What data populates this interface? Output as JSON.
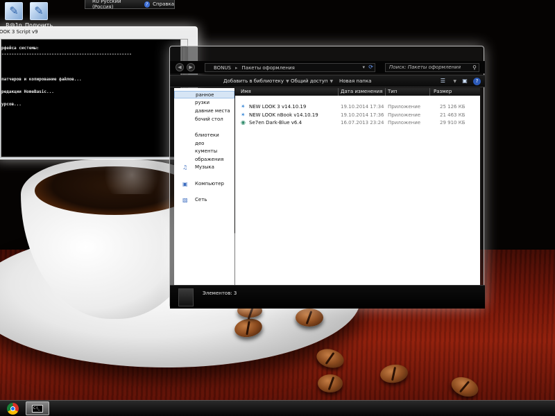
{
  "desktop": {
    "icons": [
      {
        "label": "R@1n",
        "icon": "shortcut-icon"
      },
      {
        "label": "Получить",
        "icon": "shortcut-icon"
      }
    ]
  },
  "langbar": {
    "language": "RU Русский (Россия)",
    "help": "Справка"
  },
  "console": {
    "title": "OOK 3 Script v9",
    "lines": [
      "рфейса системы:",
      "----------------------------------------------------",
      "",
      "",
      "",
      "патчеров и копирование файлов...",
      "",
      "редакции HomeBasic...",
      "",
      "урсов..."
    ]
  },
  "explorer": {
    "address": {
      "parts": [
        "BONUS",
        "Пакеты оформления"
      ]
    },
    "search_placeholder": "Поиск: Пакеты оформления",
    "toolbar": {
      "add_library": "Добавить в библиотеку",
      "share": "Общий доступ",
      "new_folder": "Новая папка"
    },
    "nav": [
      {
        "label": "ранное",
        "selected": true
      },
      {
        "label": "рузки",
        "selected": false
      },
      {
        "label": "давние места",
        "selected": false
      },
      {
        "label": "бочий стол",
        "selected": false
      },
      {
        "label": "блиотеки",
        "selected": false
      },
      {
        "label": "део",
        "selected": false
      },
      {
        "label": "кументы",
        "selected": false
      },
      {
        "label": "ображения",
        "selected": false
      },
      {
        "label": "Музыка",
        "selected": false
      },
      {
        "label": "Компьютер",
        "selected": false
      },
      {
        "label": "Сеть",
        "selected": false
      }
    ],
    "columns": {
      "name": "Имя",
      "date": "Дата изменения",
      "type": "Тип",
      "size": "Размер"
    },
    "files": [
      {
        "name": "NEW LOOK 3 v14.10.19",
        "date": "19.10.2014 17:34",
        "type": "Приложение",
        "size": "25 126 КБ"
      },
      {
        "name": "NEW LOOK nBook v14.10.19",
        "date": "19.10.2014 17:36",
        "type": "Приложение",
        "size": "21 463 КБ"
      },
      {
        "name": "Se7en Dark-Blue v6.4",
        "date": "16.07.2013 23:24",
        "type": "Приложение",
        "size": "29 910 КБ"
      }
    ],
    "status": "Элементов: 3"
  }
}
